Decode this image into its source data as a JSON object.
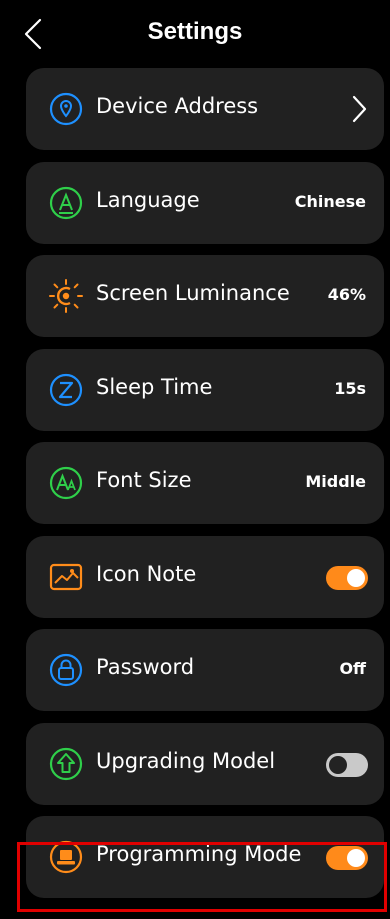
{
  "header": {
    "title": "Settings"
  },
  "items": [
    {
      "label": "Device Address",
      "icon": "location-pin-icon",
      "color": "#1e90ff"
    },
    {
      "label": "Language",
      "value": "Chinese",
      "icon": "language-icon",
      "color": "#2fcf4a"
    },
    {
      "label": "Screen Luminance",
      "value": "46%",
      "icon": "brightness-icon",
      "color": "#ff8c1a"
    },
    {
      "label": "Sleep Time",
      "value": "15s",
      "icon": "sleep-icon",
      "color": "#1e90ff"
    },
    {
      "label": "Font Size",
      "value": "Middle",
      "icon": "font-size-icon",
      "color": "#2fcf4a"
    },
    {
      "label": "Icon Note",
      "toggle": true,
      "icon": "image-icon",
      "color": "#ff8c1a"
    },
    {
      "label": "Password",
      "value": "Off",
      "icon": "lock-icon",
      "color": "#1e90ff"
    },
    {
      "label": "Upgrading Model",
      "toggle": false,
      "icon": "upgrade-icon",
      "color": "#2fcf4a"
    },
    {
      "label": "Programming Mode",
      "toggle": true,
      "icon": "programming-icon",
      "color": "#ff8c1a"
    }
  ],
  "colors": {
    "accent": "#ff8a1a",
    "highlight": "#e00000",
    "row_bg": "#212121"
  }
}
